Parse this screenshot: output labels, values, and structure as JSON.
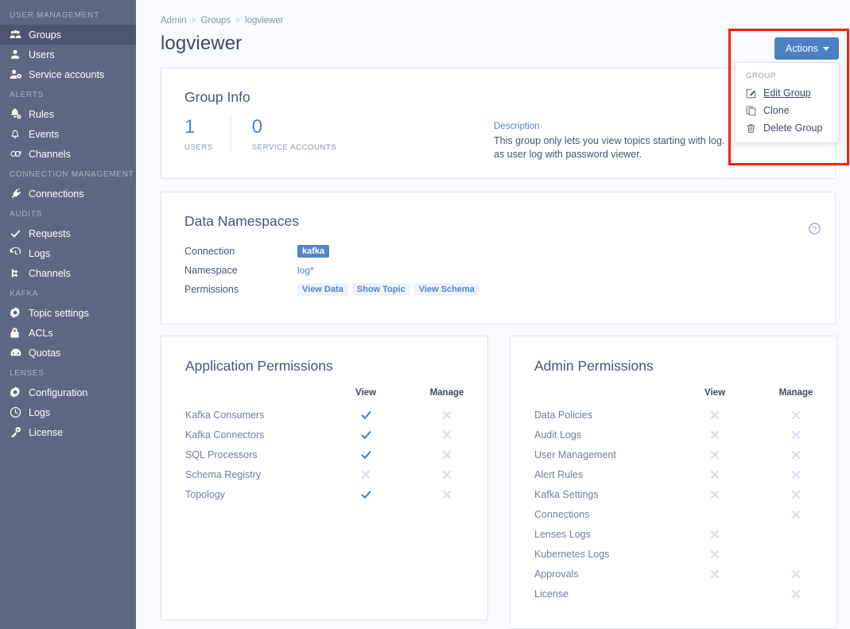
{
  "sidebar": {
    "sections": [
      {
        "label": "USER MANAGEMENT",
        "items": [
          {
            "label": "Groups",
            "icon": "groups-icon",
            "active": true
          },
          {
            "label": "Users",
            "icon": "user-icon",
            "active": false
          },
          {
            "label": "Service accounts",
            "icon": "service-account-icon",
            "active": false
          }
        ]
      },
      {
        "label": "ALERTS",
        "items": [
          {
            "label": "Rules",
            "icon": "bell-gear-icon",
            "active": false
          },
          {
            "label": "Events",
            "icon": "bell-icon",
            "active": false
          },
          {
            "label": "Channels",
            "icon": "channels-icon",
            "active": false
          }
        ]
      },
      {
        "label": "CONNECTION MANAGEMENT",
        "items": [
          {
            "label": "Connections",
            "icon": "plug-icon",
            "active": false
          }
        ]
      },
      {
        "label": "AUDITS",
        "items": [
          {
            "label": "Requests",
            "icon": "check-icon",
            "active": false
          },
          {
            "label": "Logs",
            "icon": "history-icon",
            "active": false
          },
          {
            "label": "Channels",
            "icon": "branch-icon",
            "active": false
          }
        ]
      },
      {
        "label": "KAFKA",
        "items": [
          {
            "label": "Topic settings",
            "icon": "gear-icon",
            "active": false
          },
          {
            "label": "ACLs",
            "icon": "lock-icon",
            "active": false
          },
          {
            "label": "Quotas",
            "icon": "gauge-icon",
            "active": false
          }
        ]
      },
      {
        "label": "LENSES",
        "items": [
          {
            "label": "Configuration",
            "icon": "gear-icon",
            "active": false
          },
          {
            "label": "Logs",
            "icon": "clock-icon",
            "active": false
          },
          {
            "label": "License",
            "icon": "key-icon",
            "active": false
          }
        ]
      }
    ]
  },
  "breadcrumb": {
    "items": [
      "Admin",
      "Groups",
      "logviewer"
    ],
    "separator": ">"
  },
  "page": {
    "title": "logviewer"
  },
  "actions": {
    "button_label": "Actions",
    "menu_header": "GROUP",
    "items": [
      {
        "label": "Edit Group",
        "icon": "pencil-icon"
      },
      {
        "label": "Clone",
        "icon": "copy-icon"
      },
      {
        "label": "Delete Group",
        "icon": "trash-icon"
      }
    ]
  },
  "group_info": {
    "title": "Group Info",
    "stats": [
      {
        "value": "1",
        "label": "USERS"
      },
      {
        "value": "0",
        "label": "SERVICE ACCOUNTS"
      }
    ],
    "description_label": "Description",
    "description_line1": "This group only lets you view topics starting with log.",
    "description_line2": "as user log with password viewer."
  },
  "namespaces": {
    "title": "Data Namespaces",
    "help_icon": "question-circle-icon",
    "rows": [
      {
        "key": "Connection",
        "values": [
          {
            "text": "kafka",
            "style": "solid"
          }
        ]
      },
      {
        "key": "Namespace",
        "values": [
          {
            "text": "log*",
            "style": "plain"
          }
        ]
      },
      {
        "key": "Permissions",
        "values": [
          {
            "text": "View Data",
            "style": "light"
          },
          {
            "text": "Show Topic",
            "style": "light"
          },
          {
            "text": "View Schema",
            "style": "light"
          }
        ]
      }
    ]
  },
  "application_permissions": {
    "title": "Application Permissions",
    "columns": [
      "View",
      "Manage"
    ],
    "rows": [
      {
        "label": "Kafka Consumers",
        "view": "check",
        "manage": "cross"
      },
      {
        "label": "Kafka Connectors",
        "view": "check",
        "manage": "cross"
      },
      {
        "label": "SQL Processors",
        "view": "check",
        "manage": "cross"
      },
      {
        "label": "Schema Registry",
        "view": "cross",
        "manage": "cross"
      },
      {
        "label": "Topology",
        "view": "check",
        "manage": "cross"
      }
    ]
  },
  "admin_permissions": {
    "title": "Admin Permissions",
    "columns": [
      "View",
      "Manage"
    ],
    "rows": [
      {
        "label": "Data Policies",
        "view": "cross",
        "manage": "cross"
      },
      {
        "label": "Audit Logs",
        "view": "cross",
        "manage": "cross"
      },
      {
        "label": "User Management",
        "view": "cross",
        "manage": "cross"
      },
      {
        "label": "Alert Rules",
        "view": "cross",
        "manage": "cross"
      },
      {
        "label": "Kafka Settings",
        "view": "cross",
        "manage": "cross"
      },
      {
        "label": "Connections",
        "view": "none",
        "manage": "cross"
      },
      {
        "label": "Lenses Logs",
        "view": "cross",
        "manage": "none"
      },
      {
        "label": "Kubernetes Logs",
        "view": "cross",
        "manage": "none"
      },
      {
        "label": "Approvals",
        "view": "cross",
        "manage": "cross"
      },
      {
        "label": "License",
        "view": "none",
        "manage": "cross"
      }
    ]
  },
  "colors": {
    "sidebar_bg": "#5c6782",
    "sidebar_active": "#4b5570",
    "accent_blue": "#5585c5",
    "button_blue": "#4a80c4",
    "check_blue": "#4a80c4",
    "cross_grey": "#d9dfeb",
    "highlight_red": "#ff1e00",
    "page_bg": "#f8fafd"
  }
}
